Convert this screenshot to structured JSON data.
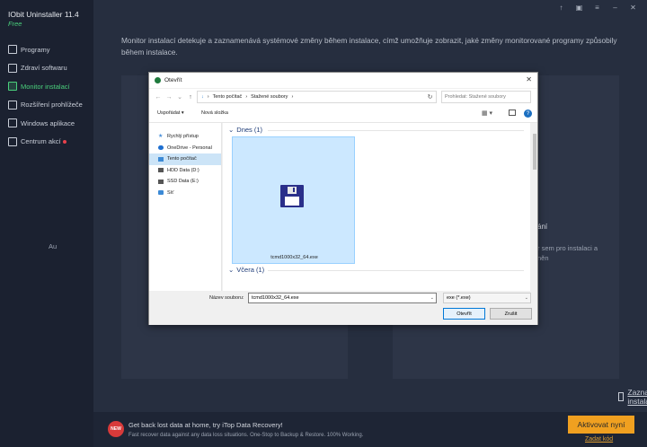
{
  "app": {
    "title": "IObit Uninstaller 11.4",
    "edition": "Free"
  },
  "sidebar": {
    "items": [
      {
        "label": "Programy",
        "active": false
      },
      {
        "label": "Zdraví softwaru",
        "active": false
      },
      {
        "label": "Monitor instalací",
        "active": true
      },
      {
        "label": "Rozšíření prohlížeče",
        "active": false
      },
      {
        "label": "Windows aplikace",
        "active": false
      },
      {
        "label": "Centrum akcí",
        "active": false
      }
    ]
  },
  "main": {
    "description": "Monitor instalací detekuje a zaznamenává systémové změny během instalace, címž umožňuje zobrazit, jaké změny monitorované programy způsobily během instalace.",
    "left_panel_text": "Au",
    "right_panel_title": "ání",
    "right_panel_text": "r sem pro instalaci a\nněn",
    "recorded_link": "Zaznamenané instalace"
  },
  "promo": {
    "badge": "NEW",
    "title": "Get back lost data at home, try iTop Data Recovery!",
    "subtitle": "Fast recover data against any data loss situations. One-Stop to Backup & Restore. 100% Working.",
    "activate_label": "Aktivovat nyní",
    "code_label": "Zadat kód"
  },
  "dialog": {
    "title": "Otevřít",
    "address": {
      "segments": [
        "Tento počítač",
        "Stažené soubory"
      ]
    },
    "search_placeholder": "Prohledat: Stažené soubory",
    "toolbar": {
      "organize": "Uspořádat ▾",
      "new_folder": "Nová složka"
    },
    "nav": [
      {
        "label": "Rychlý přístup",
        "selected": false,
        "color": "#4a90d9"
      },
      {
        "label": "OneDrive - Personal",
        "selected": false,
        "color": "#1e6fd0"
      },
      {
        "label": "Tento počítač",
        "selected": true,
        "color": "#3c8ad6"
      },
      {
        "label": "HDD Data (D:)",
        "selected": false,
        "color": "#555555"
      },
      {
        "label": "SSD Data (E:)",
        "selected": false,
        "color": "#555555"
      },
      {
        "label": "Síť",
        "selected": false,
        "color": "#3c8ad6"
      }
    ],
    "groups": {
      "today": "Dnes (1)",
      "yesterday": "Včera (1)"
    },
    "file_name": "tcmd1000x32_64.exe",
    "file_name_label": "Název souboru:",
    "file_name_value": "tcmd1000x32_64.exe",
    "file_type": "exe (*.exe)",
    "open_label": "Otevřít",
    "cancel_label": "Zrušit"
  }
}
